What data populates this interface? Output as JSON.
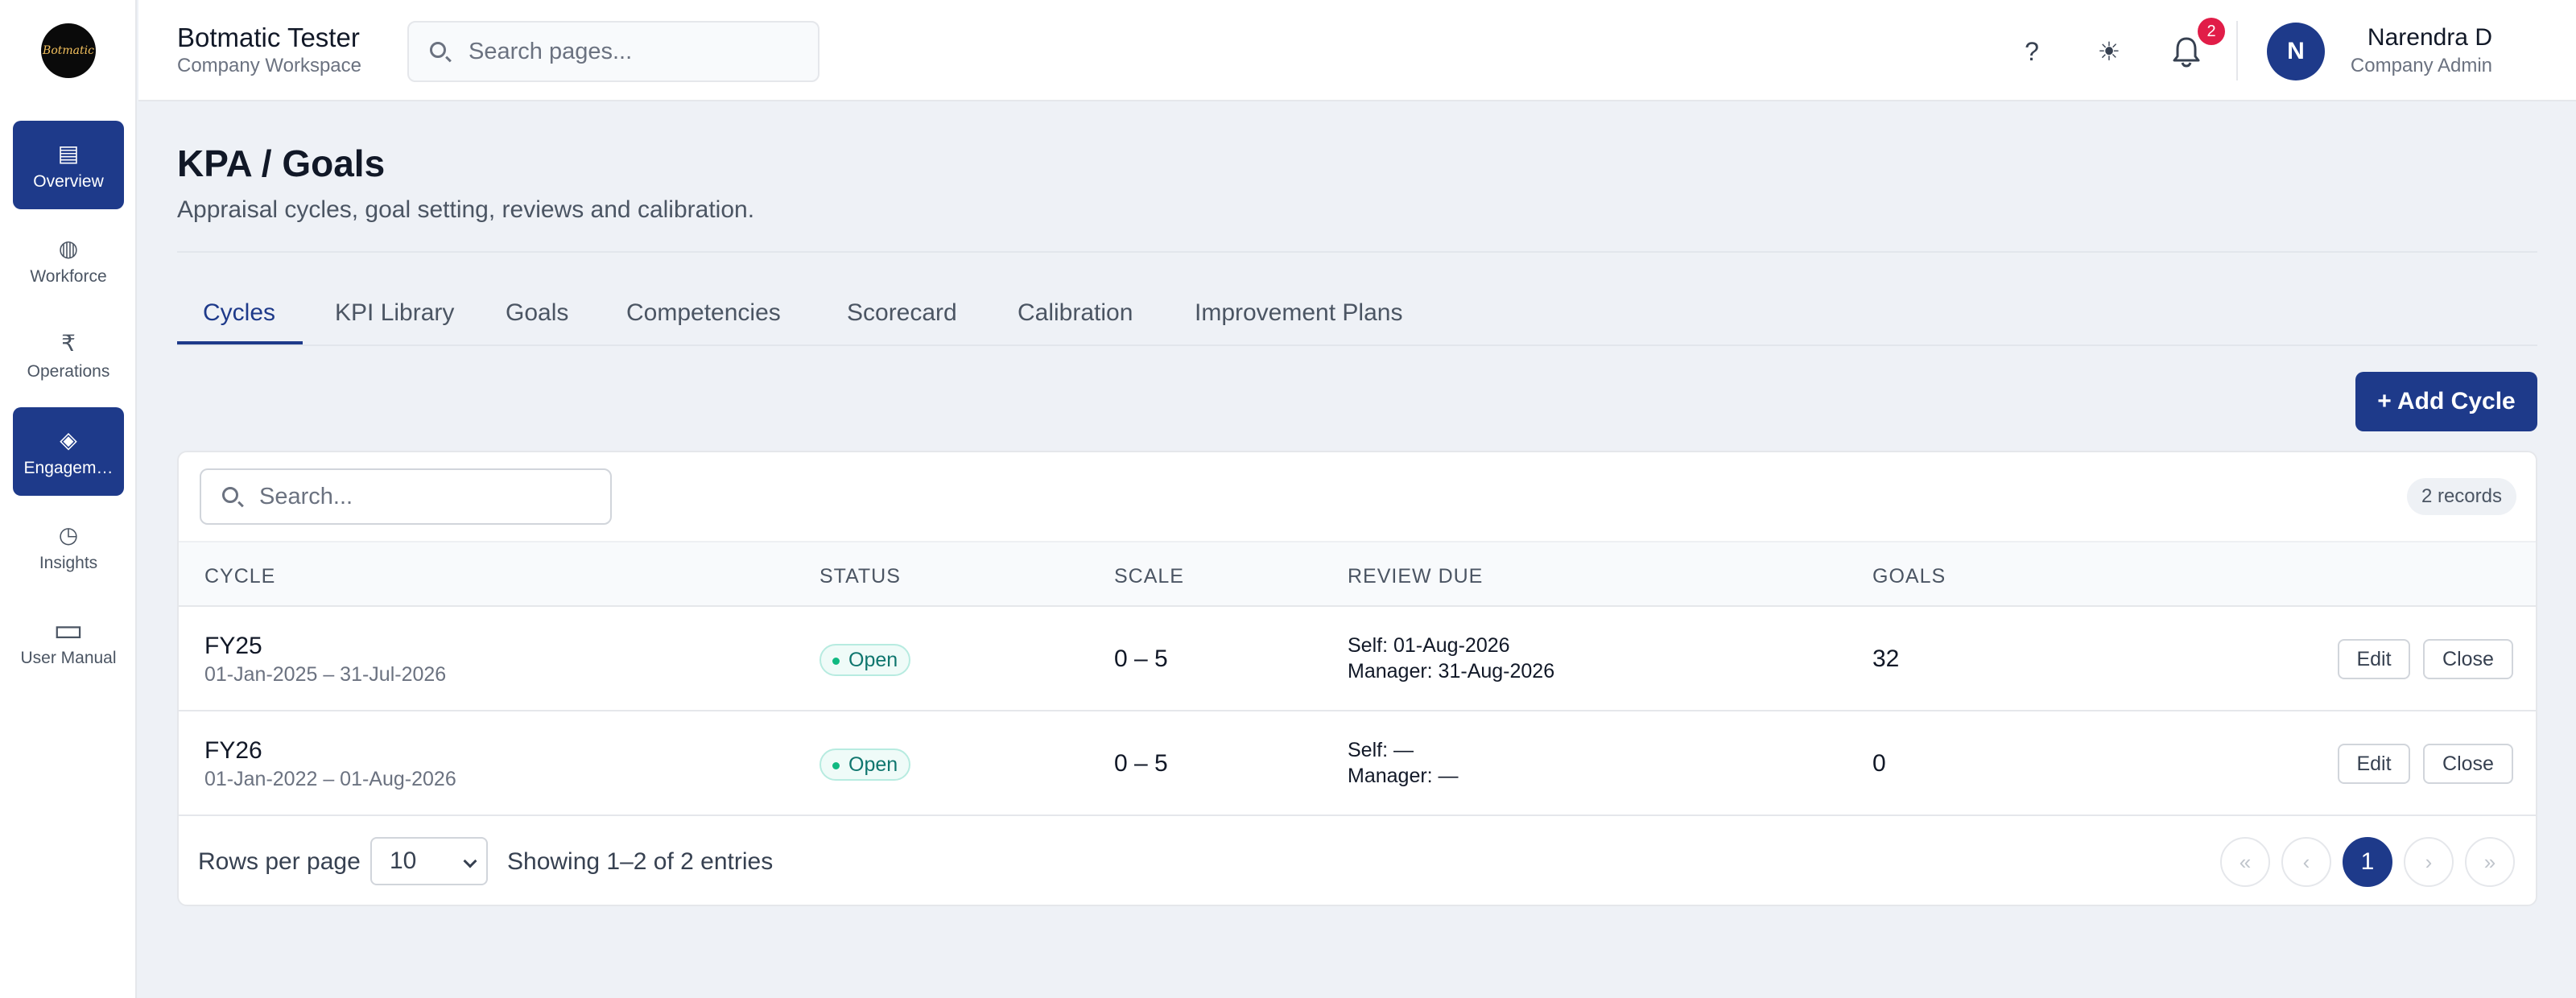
{
  "sidebar": {
    "logo_text": "Botmatic",
    "items": [
      {
        "label": "Overview",
        "icon": "▤"
      },
      {
        "label": "Workforce",
        "icon": "◍"
      },
      {
        "label": "Operations",
        "icon": "₹"
      },
      {
        "label": "Engagem…",
        "icon": "◈"
      },
      {
        "label": "Insights",
        "icon": "◷"
      },
      {
        "label": "User Manual",
        "icon": "▭"
      }
    ]
  },
  "header": {
    "title": "Botmatic Tester",
    "subtitle": "Company Workspace",
    "search_placeholder": "Search pages...",
    "help_icon": "?",
    "theme_icon": "☀",
    "bell_icon": "🔔",
    "notification_count": "2",
    "user": {
      "initial": "N",
      "name": "Narendra D",
      "role": "Company Admin",
      "caret": "▾"
    }
  },
  "page": {
    "title": "KPA / Goals",
    "subtitle": "Appraisal cycles, goal setting, reviews and calibration."
  },
  "tabs": [
    {
      "label": "Cycles"
    },
    {
      "label": "KPI Library"
    },
    {
      "label": "Goals"
    },
    {
      "label": "Competencies"
    },
    {
      "label": "Scorecard"
    },
    {
      "label": "Calibration"
    },
    {
      "label": "Improvement Plans"
    }
  ],
  "toolbar": {
    "add_label": "+ Add Cycle"
  },
  "table": {
    "search_placeholder": "Search...",
    "records": "2 records",
    "columns": [
      "CYCLE",
      "STATUS",
      "SCALE",
      "REVIEW DUE",
      "GOALS"
    ],
    "rows": [
      {
        "name": "FY25",
        "dates": "01-Jan-2025 – 31-Jul-2026",
        "status": "Open",
        "scale": "0 – 5",
        "self_due": "Self: 01-Aug-2026",
        "manager_due": "Manager: 31-Aug-2026",
        "goals": "32",
        "edit": "Edit",
        "close": "Close"
      },
      {
        "name": "FY26",
        "dates": "01-Jan-2022 – 01-Aug-2026",
        "status": "Open",
        "scale": "0 – 5",
        "self_due": "Self: —",
        "manager_due": "Manager: —",
        "goals": "0",
        "edit": "Edit",
        "close": "Close"
      }
    ]
  },
  "pagination": {
    "rows_per_page_label": "Rows per page",
    "rows_per_page_value": "10",
    "showing": "Showing 1–2 of 2 entries",
    "first": "«",
    "prev": "‹",
    "current": "1",
    "next": "›",
    "last": "»"
  },
  "colors": {
    "accent": "#1e3a8a",
    "badge": "#e11d48",
    "status_open": "#0f766e"
  }
}
